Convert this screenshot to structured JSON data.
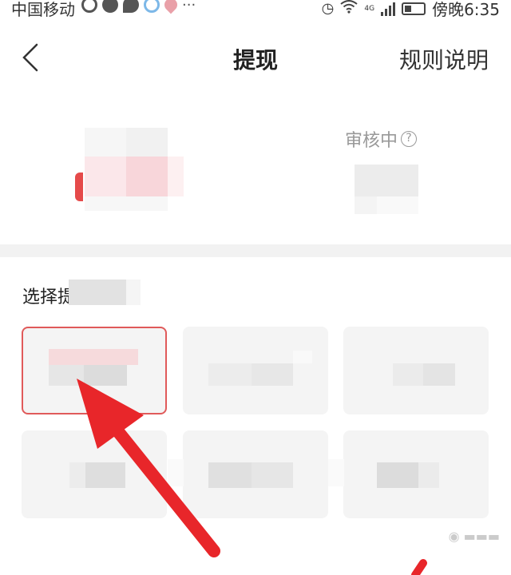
{
  "status_bar": {
    "carrier": "中国移动",
    "network": "4G",
    "time": "傍晚6:35"
  },
  "nav": {
    "title": "提现",
    "rules_label": "规则说明"
  },
  "balance": {
    "review_label": "审核中"
  },
  "section": {
    "select_label": "选择提"
  },
  "icons": {
    "back": "chevron-left-icon",
    "help": "question-circle-icon"
  },
  "colors": {
    "selected_border": "#e05a5a",
    "arrow": "#e8262a",
    "option_bg": "#f4f4f4"
  },
  "options": {
    "selected_index": 0,
    "count": 6
  }
}
